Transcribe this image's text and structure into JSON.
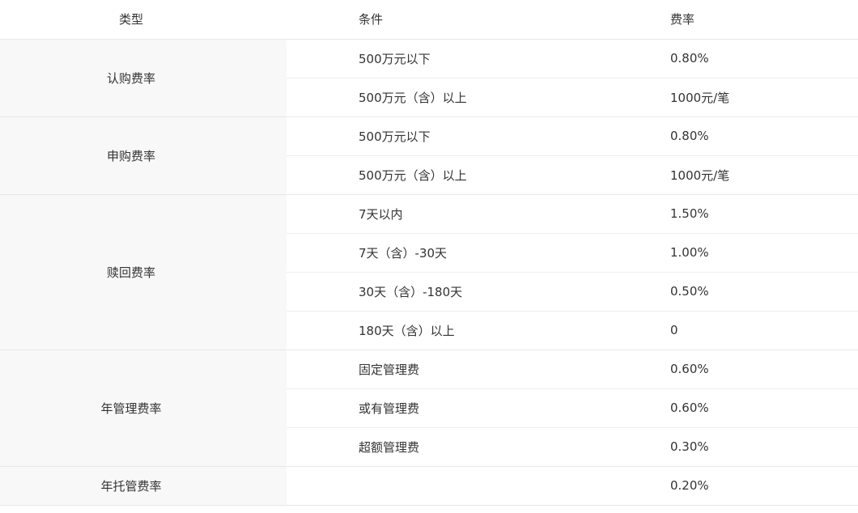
{
  "table": {
    "headers": {
      "type": "类型",
      "condition": "条件",
      "rate": "费率"
    },
    "groups": [
      {
        "type": "认购费率",
        "rows": [
          {
            "condition": "500万元以下",
            "rate": "0.80%"
          },
          {
            "condition": "500万元（含）以上",
            "rate": "1000元/笔"
          }
        ]
      },
      {
        "type": "申购费率",
        "rows": [
          {
            "condition": "500万元以下",
            "rate": "0.80%"
          },
          {
            "condition": "500万元（含）以上",
            "rate": "1000元/笔"
          }
        ]
      },
      {
        "type": "赎回费率",
        "rows": [
          {
            "condition": "7天以内",
            "rate": "1.50%"
          },
          {
            "condition": "7天（含）-30天",
            "rate": "1.00%"
          },
          {
            "condition": "30天（含）-180天",
            "rate": "0.50%"
          },
          {
            "condition": "180天（含）以上",
            "rate": "0"
          }
        ]
      },
      {
        "type": "年管理费率",
        "rows": [
          {
            "condition": "固定管理费",
            "rate": "0.60%"
          },
          {
            "condition": "或有管理费",
            "rate": "0.60%"
          },
          {
            "condition": "超额管理费",
            "rate": "0.30%"
          }
        ]
      },
      {
        "type": "年托管费率",
        "rows": [
          {
            "condition": "",
            "rate": "0.20%"
          }
        ]
      }
    ]
  }
}
